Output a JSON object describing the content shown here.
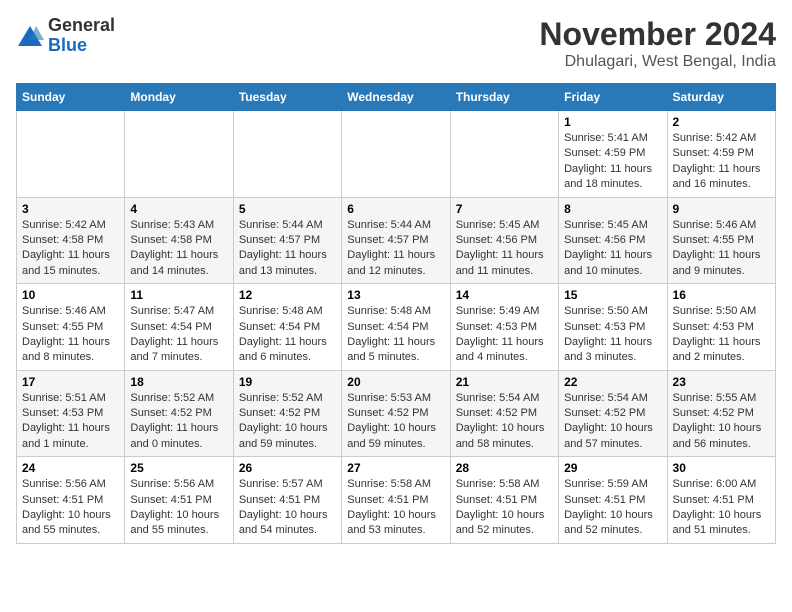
{
  "logo": {
    "general": "General",
    "blue": "Blue"
  },
  "header": {
    "month": "November 2024",
    "location": "Dhulagari, West Bengal, India"
  },
  "weekdays": [
    "Sunday",
    "Monday",
    "Tuesday",
    "Wednesday",
    "Thursday",
    "Friday",
    "Saturday"
  ],
  "weeks": [
    [
      {
        "day": "",
        "info": ""
      },
      {
        "day": "",
        "info": ""
      },
      {
        "day": "",
        "info": ""
      },
      {
        "day": "",
        "info": ""
      },
      {
        "day": "",
        "info": ""
      },
      {
        "day": "1",
        "info": "Sunrise: 5:41 AM\nSunset: 4:59 PM\nDaylight: 11 hours and 18 minutes."
      },
      {
        "day": "2",
        "info": "Sunrise: 5:42 AM\nSunset: 4:59 PM\nDaylight: 11 hours and 16 minutes."
      }
    ],
    [
      {
        "day": "3",
        "info": "Sunrise: 5:42 AM\nSunset: 4:58 PM\nDaylight: 11 hours and 15 minutes."
      },
      {
        "day": "4",
        "info": "Sunrise: 5:43 AM\nSunset: 4:58 PM\nDaylight: 11 hours and 14 minutes."
      },
      {
        "day": "5",
        "info": "Sunrise: 5:44 AM\nSunset: 4:57 PM\nDaylight: 11 hours and 13 minutes."
      },
      {
        "day": "6",
        "info": "Sunrise: 5:44 AM\nSunset: 4:57 PM\nDaylight: 11 hours and 12 minutes."
      },
      {
        "day": "7",
        "info": "Sunrise: 5:45 AM\nSunset: 4:56 PM\nDaylight: 11 hours and 11 minutes."
      },
      {
        "day": "8",
        "info": "Sunrise: 5:45 AM\nSunset: 4:56 PM\nDaylight: 11 hours and 10 minutes."
      },
      {
        "day": "9",
        "info": "Sunrise: 5:46 AM\nSunset: 4:55 PM\nDaylight: 11 hours and 9 minutes."
      }
    ],
    [
      {
        "day": "10",
        "info": "Sunrise: 5:46 AM\nSunset: 4:55 PM\nDaylight: 11 hours and 8 minutes."
      },
      {
        "day": "11",
        "info": "Sunrise: 5:47 AM\nSunset: 4:54 PM\nDaylight: 11 hours and 7 minutes."
      },
      {
        "day": "12",
        "info": "Sunrise: 5:48 AM\nSunset: 4:54 PM\nDaylight: 11 hours and 6 minutes."
      },
      {
        "day": "13",
        "info": "Sunrise: 5:48 AM\nSunset: 4:54 PM\nDaylight: 11 hours and 5 minutes."
      },
      {
        "day": "14",
        "info": "Sunrise: 5:49 AM\nSunset: 4:53 PM\nDaylight: 11 hours and 4 minutes."
      },
      {
        "day": "15",
        "info": "Sunrise: 5:50 AM\nSunset: 4:53 PM\nDaylight: 11 hours and 3 minutes."
      },
      {
        "day": "16",
        "info": "Sunrise: 5:50 AM\nSunset: 4:53 PM\nDaylight: 11 hours and 2 minutes."
      }
    ],
    [
      {
        "day": "17",
        "info": "Sunrise: 5:51 AM\nSunset: 4:53 PM\nDaylight: 11 hours and 1 minute."
      },
      {
        "day": "18",
        "info": "Sunrise: 5:52 AM\nSunset: 4:52 PM\nDaylight: 11 hours and 0 minutes."
      },
      {
        "day": "19",
        "info": "Sunrise: 5:52 AM\nSunset: 4:52 PM\nDaylight: 10 hours and 59 minutes."
      },
      {
        "day": "20",
        "info": "Sunrise: 5:53 AM\nSunset: 4:52 PM\nDaylight: 10 hours and 59 minutes."
      },
      {
        "day": "21",
        "info": "Sunrise: 5:54 AM\nSunset: 4:52 PM\nDaylight: 10 hours and 58 minutes."
      },
      {
        "day": "22",
        "info": "Sunrise: 5:54 AM\nSunset: 4:52 PM\nDaylight: 10 hours and 57 minutes."
      },
      {
        "day": "23",
        "info": "Sunrise: 5:55 AM\nSunset: 4:52 PM\nDaylight: 10 hours and 56 minutes."
      }
    ],
    [
      {
        "day": "24",
        "info": "Sunrise: 5:56 AM\nSunset: 4:51 PM\nDaylight: 10 hours and 55 minutes."
      },
      {
        "day": "25",
        "info": "Sunrise: 5:56 AM\nSunset: 4:51 PM\nDaylight: 10 hours and 55 minutes."
      },
      {
        "day": "26",
        "info": "Sunrise: 5:57 AM\nSunset: 4:51 PM\nDaylight: 10 hours and 54 minutes."
      },
      {
        "day": "27",
        "info": "Sunrise: 5:58 AM\nSunset: 4:51 PM\nDaylight: 10 hours and 53 minutes."
      },
      {
        "day": "28",
        "info": "Sunrise: 5:58 AM\nSunset: 4:51 PM\nDaylight: 10 hours and 52 minutes."
      },
      {
        "day": "29",
        "info": "Sunrise: 5:59 AM\nSunset: 4:51 PM\nDaylight: 10 hours and 52 minutes."
      },
      {
        "day": "30",
        "info": "Sunrise: 6:00 AM\nSunset: 4:51 PM\nDaylight: 10 hours and 51 minutes."
      }
    ]
  ]
}
